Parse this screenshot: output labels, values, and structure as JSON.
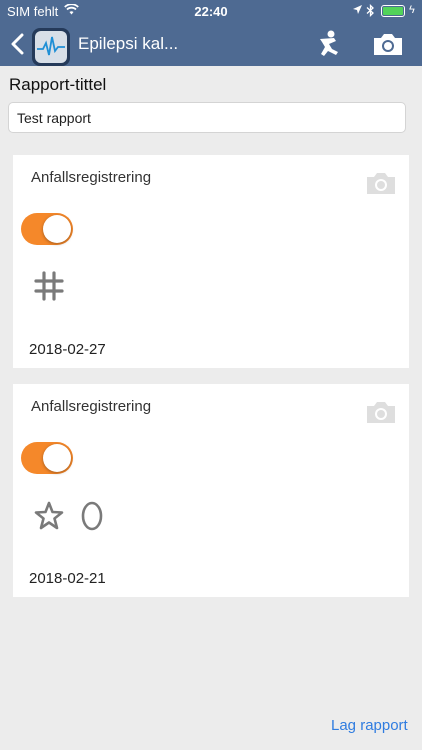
{
  "status_bar": {
    "carrier": "SIM fehlt",
    "time": "22:40",
    "charge_symbol": "ϟ"
  },
  "nav": {
    "title": "Epilepsi kal...",
    "icons": [
      "chevron-left-icon",
      "app-icon",
      "person-icon",
      "camera-icon"
    ]
  },
  "form": {
    "title_label": "Rapport-tittel",
    "title_value": "Test rapport"
  },
  "cards": [
    {
      "title": "Anfallsregistrering",
      "enabled": true,
      "symbol": "hash-icon",
      "date": "2018-02-27"
    },
    {
      "title": "Anfallsregistrering",
      "enabled": true,
      "symbols": [
        "star-icon",
        "zero-icon"
      ],
      "date": "2018-02-21"
    }
  ],
  "footer": {
    "create_report_label": "Lag rapport"
  },
  "colors": {
    "nav_background": "#4e6a92",
    "toggle_on": "#f5882a",
    "link": "#2f7ce0",
    "battery": "#52d35a"
  }
}
